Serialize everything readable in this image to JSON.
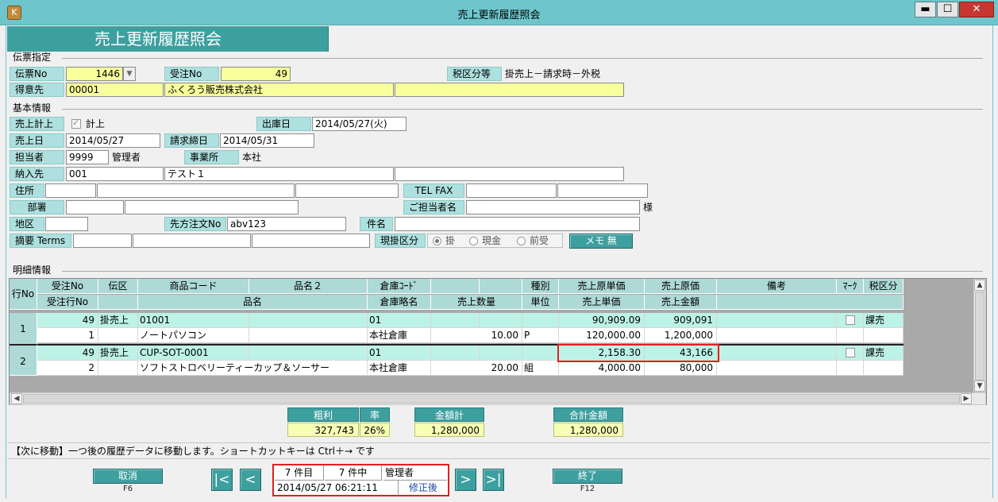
{
  "window": {
    "title": "売上更新履歴照会",
    "minimize": "▬",
    "maximize": "☐",
    "close": "✕",
    "app_icon_glyph": "K"
  },
  "screen_title": "売上更新履歴照会",
  "denpyo": {
    "section": "伝票指定",
    "denpyo_no_label": "伝票No",
    "denpyo_no": "1446",
    "juchu_no_label": "受注No",
    "juchu_no": "49",
    "zei_label": "税区分等",
    "zei_value": "掛売上－請求時－外税",
    "tokuisaki_label": "得意先",
    "tokuisaki_code": "00001",
    "tokuisaki_name": "ふくろう販売株式会社"
  },
  "kihon": {
    "section": "基本情報",
    "keijo_label": "売上計上",
    "keijo_check": "計上",
    "shukko_label": "出庫日",
    "shukko_value": "2014/05/27(火)",
    "uriage_label": "売上日",
    "uriage_value": "2014/05/27",
    "seikyu_label": "請求締日",
    "seikyu_value": "2014/05/31",
    "tanto_label": "担当者",
    "tanto_code": "9999",
    "tanto_name": "管理者",
    "jigyo_label": "事業所",
    "jigyo_value": "本社",
    "nonyu_label": "納入先",
    "nonyu_code": "001",
    "nonyu_name": "テスト１",
    "jusho_label": "住所",
    "tel_label": "TEL FAX",
    "busho_label": "部署",
    "gotanto_label": "ご担当者名",
    "sama": "様",
    "chiku_label": "地区",
    "sakikata_label": "先方注文No",
    "sakikata_value": "abv123",
    "kenmei_label": "件名",
    "tekiyo_label": "摘要 Terms",
    "genkake_label": "現掛区分",
    "radio_kake": "掛",
    "radio_genkin": "現金",
    "radio_maeuke": "前受",
    "memo_button": "メモ 無"
  },
  "meisai": {
    "section": "明細情報",
    "header1": [
      "受注No",
      "伝区",
      "商品コード",
      "品名２",
      "倉庫ｺｰﾄﾞ",
      "",
      "",
      "種別",
      "売上原単価",
      "売上原価",
      "備考",
      "ﾏｰｸ",
      "税区分"
    ],
    "header2": [
      "受注行No",
      "",
      "品名",
      "倉庫略名",
      "売上数量",
      "単位",
      "売上単価",
      "売上金額",
      ""
    ],
    "row_header": "行No",
    "rows": [
      {
        "no": "1",
        "l1": {
          "juchu": "49",
          "denku": "掛売上",
          "code": "01001",
          "hinmei2": "",
          "soko_code": "01",
          "c6": "",
          "c7": "",
          "shubetsu": "",
          "gen_tanka": "90,909.09",
          "gen_ka": "909,091",
          "biko": "",
          "zei": "課売"
        },
        "l2": {
          "gyo": "1",
          "hinmei": "ノートパソコン",
          "soko": "本社倉庫",
          "suryo": "10.00",
          "tani": "P",
          "tanka": "120,000.00",
          "kingaku": "1,200,000"
        }
      },
      {
        "no": "2",
        "l1": {
          "juchu": "49",
          "denku": "掛売上",
          "code": "CUP-SOT-0001",
          "hinmei2": "",
          "soko_code": "01",
          "c6": "",
          "c7": "",
          "shubetsu": "",
          "gen_tanka": "2,158.30",
          "gen_ka": "43,166",
          "biko": "",
          "zei": "課売"
        },
        "l2": {
          "gyo": "2",
          "hinmei": "ソフトストロベリーティーカップ＆ソーサー",
          "soko": "本社倉庫",
          "suryo": "20.00",
          "tani": "組",
          "tanka": "4,000.00",
          "kingaku": "80,000"
        }
      }
    ]
  },
  "summary": {
    "arari_label": "粗利",
    "arari": "327,743",
    "ritsu_label": "率",
    "ritsu": "26%",
    "kingaku_label": "金額計",
    "kingaku": "1,280,000",
    "gokei_label": "合計金額",
    "gokei": "1,280,000"
  },
  "status_text": "【次に移動】一つ後の履歴データに移動します。ショートカットキーは Ctrl＋→ です",
  "footer": {
    "cancel": "取消",
    "cancel_key": "F6",
    "first": "|<",
    "prev": "<",
    "next": ">",
    "last": ">|",
    "current": "7 件目",
    "total": "7 件中",
    "user": "管理者",
    "datetime": "2014/05/27 06:21:11",
    "state": "修正後",
    "exit": "終了",
    "exit_key": "F12"
  },
  "colors": {
    "teal": "#3e9f9f",
    "label_bg": "#ade0de",
    "yellow": "#f7ff9c",
    "highlight": "#e02020"
  }
}
